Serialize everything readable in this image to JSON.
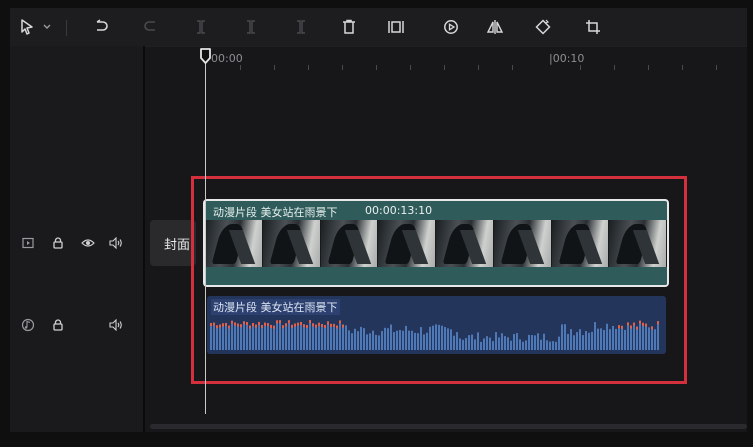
{
  "toolbar": {
    "items": [
      {
        "name": "select-pointer-icon",
        "enabled": true
      },
      {
        "name": "chevron-down-icon",
        "enabled": true
      },
      {
        "name": "undo-icon",
        "enabled": true
      },
      {
        "name": "redo-icon",
        "enabled": false
      },
      {
        "name": "split-icon",
        "enabled": false
      },
      {
        "name": "split-left-icon",
        "enabled": false
      },
      {
        "name": "split-right-icon",
        "enabled": false
      },
      {
        "name": "delete-icon",
        "enabled": true
      },
      {
        "name": "freeze-frame-icon",
        "enabled": true
      },
      {
        "name": "reverse-play-icon",
        "enabled": true
      },
      {
        "name": "mirror-icon",
        "enabled": true
      },
      {
        "name": "rotate-icon",
        "enabled": true
      },
      {
        "name": "crop-icon",
        "enabled": true
      }
    ]
  },
  "ruler": {
    "labels": [
      "00:00",
      "|00:10"
    ]
  },
  "tracks": {
    "video": {
      "icons": [
        "video-track-icon",
        "lock-icon",
        "eye-icon",
        "volume-icon"
      ]
    },
    "audio": {
      "icons": [
        "music-track-icon",
        "lock-icon",
        "volume-icon"
      ]
    }
  },
  "cover": {
    "label": "封面"
  },
  "video_clip": {
    "title": "动漫片段 美女站在雨景下",
    "duration": "00:00:13:10"
  },
  "audio_clip": {
    "title": "动漫片段 美女站在雨景下"
  },
  "colors": {
    "video_clip": "#2f5b5a",
    "audio_clip": "#24355c",
    "highlight": "#d32f3c",
    "waveform": "#4f78b6",
    "waveform_peak": "#e0604a"
  }
}
